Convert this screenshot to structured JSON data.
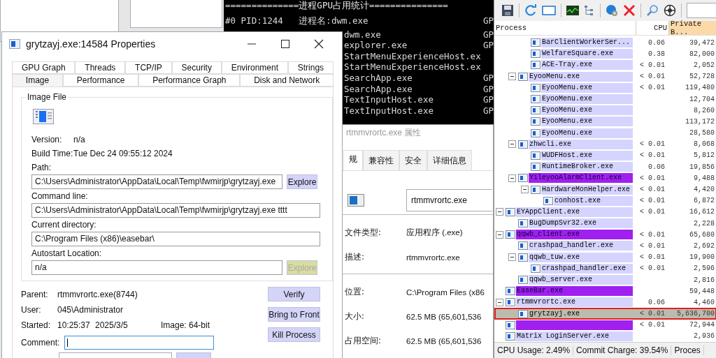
{
  "console": {
    "header": "==============进程GPU占用统计===============",
    "lines": [
      {
        "kind": "full",
        "text": "#0 PID:1244   进程名:dwm.exe",
        "tail": "GP"
      },
      {
        "kind": "tail",
        "text": "dwm.exe",
        "tail": "GP"
      },
      {
        "kind": "tail",
        "text": "explorer.exe",
        "tail": "GP"
      },
      {
        "kind": "tail",
        "text": "StartMenuExperienceHost.ex"
      },
      {
        "kind": "tail",
        "text": "StartMenuExperienceHost.ex"
      },
      {
        "kind": "tail",
        "text": "SearchApp.exe",
        "tail": "GP"
      },
      {
        "kind": "tail",
        "text": "SearchApp.exe",
        "tail": "GP"
      },
      {
        "kind": "tail",
        "text": "TextInputHost.exe",
        "tail": "GP"
      },
      {
        "kind": "tail",
        "text": "TextInputHost.exe",
        "tail": "GP"
      }
    ]
  },
  "properties_cn": {
    "title": "rtmmvrortc.exe 属性",
    "tabs": [
      {
        "label": "规",
        "selected": true
      },
      {
        "label": "兼容性",
        "selected": false
      },
      {
        "label": "安全",
        "selected": false
      },
      {
        "label": "详细信息",
        "selected": false
      }
    ],
    "file_name": "rtmmvrortc.exe",
    "groups": [
      [
        {
          "label": "文件类型:",
          "value": "应用程序 (.exe)"
        },
        {
          "label": "描述:",
          "value": "rtmmvrortc.exe"
        }
      ],
      [
        {
          "label": "位置:",
          "value": "C:\\Program Files (x86"
        },
        {
          "label": "大小:",
          "value": "62.5 MB (65,601,536"
        },
        {
          "label": "占用空间:",
          "value": "62.5 MB (65,601,536"
        }
      ]
    ]
  },
  "properties": {
    "title": "grytzayj.exe:14584 Properties",
    "tabs_row1": [
      {
        "label": "GPU Graph",
        "selected": false
      },
      {
        "label": "Threads",
        "selected": false
      },
      {
        "label": "TCP/IP",
        "selected": false
      },
      {
        "label": "Security",
        "selected": false
      },
      {
        "label": "Environment",
        "selected": false
      },
      {
        "label": "Strings",
        "selected": false
      }
    ],
    "tabs_row2": [
      {
        "label": "Image",
        "selected": true
      },
      {
        "label": "Performance",
        "selected": false
      },
      {
        "label": "Performance Graph",
        "selected": false
      },
      {
        "label": "Disk and Network",
        "selected": false
      }
    ],
    "group_title": "Image File",
    "info": [
      {
        "label": "Version:",
        "value": "n/a"
      },
      {
        "label": "Build Time:",
        "value": "Tue Dec 24 09:55:12 2024"
      }
    ],
    "fields": [
      {
        "label": "Path:",
        "value": "C:\\Users\\Administrator\\AppData\\Local\\Temp\\fwmirjp\\grytzayj.exe",
        "button": {
          "label": "Explore",
          "disabled": false
        }
      },
      {
        "label": "Command line:",
        "value": "C:\\Users\\Administrator\\AppData\\Local\\Temp\\fwmirjp\\grytzayj.exe tttt"
      },
      {
        "label": "Current directory:",
        "value": "C:\\Program Files (x86)\\easebar\\"
      },
      {
        "label": "Autostart Location:",
        "value": "n/a",
        "button": {
          "label": "Explore",
          "disabled": true
        }
      }
    ],
    "parent": {
      "label": "Parent:",
      "value": "rtmmvrortc.exe(8744)"
    },
    "user": {
      "label": "User:",
      "value": "045\\Administrator"
    },
    "started": {
      "label": "Started:",
      "time": "10:25:37",
      "date": "2025/3/5",
      "image": "Image: 64-bit"
    },
    "comment": {
      "label": "Comment:",
      "focused": true
    },
    "buttons": [
      "Verify",
      "Bring to Front",
      "Kill Process"
    ]
  },
  "process_explorer": {
    "columns": [
      {
        "label": "Process",
        "sorted": false
      },
      {
        "label": "CPU",
        "sorted": false
      },
      {
        "label": "Private B...",
        "sorted": true
      }
    ],
    "process_tree": [
      {
        "children": [
          {
            "children": [
              {
                "name": "BarClientWorkerSer...",
                "cpu": "0.06",
                "private": "39,472",
                "color": "#d4d4ff",
                "selected": false
              },
              {
                "name": "WelfareSquare.exe",
                "cpu": "0.38",
                "private": "82,000",
                "color": "#d4d4ff",
                "selected": false
              },
              {
                "name": "ACE-Tray.exe",
                "cpu": "< 0.01",
                "private": "2,052",
                "color": "#d4d4ff",
                "selected": false
              }
            ]
          },
          {
            "name": "EyooMenu.exe",
            "cpu": "< 0.01",
            "private": "52,728",
            "color": "#d4d4ff",
            "selected": false,
            "expanded": true,
            "children": [
              {
                "name": "EyooMenu.exe",
                "cpu": "< 0.01",
                "private": "119,480",
                "color": "#d4d4ff",
                "selected": false
              },
              {
                "name": "EyooMenu.exe",
                "private": "12,704",
                "color": "#d4d4ff",
                "selected": false
              },
              {
                "name": "EyooMenu.exe",
                "private": "8,260",
                "color": "#d4d4ff",
                "selected": false
              },
              {
                "name": "EyooMenu.exe",
                "private": "113,172",
                "color": "#d4d4ff",
                "selected": false
              },
              {
                "name": "EyooMenu.exe",
                "private": "28,580",
                "color": "#d4d4ff",
                "selected": false
              }
            ]
          },
          {
            "name": "zhwcli.exe",
            "cpu": "< 0.01",
            "private": "8,068",
            "color": "#d4d4ff",
            "selected": false,
            "expanded": true,
            "children": [
              {
                "name": "WUDFHost.exe",
                "cpu": "< 0.01",
                "private": "5,812",
                "color": "#d4d4ff",
                "selected": false
              },
              {
                "name": "RuntimeBroker.exe",
                "cpu": "0.06",
                "private": "19,856",
                "color": "#d4d4ff",
                "selected": false
              }
            ]
          },
          {
            "name": "YileyooAlarmClient.exe",
            "cpu": "< 0.01",
            "private": "9,488",
            "color": "#a020f0",
            "selected": false,
            "expanded": true,
            "children": [
              {
                "name": "HardwareMonHelper.exe",
                "cpu": "< 0.01",
                "private": "4,420",
                "color": "#d4d4ff",
                "selected": false,
                "expanded": true,
                "children": [
                  {
                    "name": "conhost.exe",
                    "cpu": "< 0.01",
                    "private": "6,872",
                    "color": "#d4d4ff",
                    "selected": false
                  }
                ]
              }
            ]
          }
        ]
      },
      {
        "name": "EYAppClient.exe",
        "cpu": "< 0.01",
        "private": "16,612",
        "color": "#d4d4ff",
        "selected": false,
        "expanded": true,
        "children": [
          {
            "name": "BugDumpSvr32.exe",
            "private": "2,228",
            "color": "#d4d4ff",
            "selected": false
          }
        ]
      },
      {
        "name": "qqwb_client.exe",
        "cpu": "< 0.01",
        "private": "65,680",
        "color": "#a020f0",
        "selected": false,
        "expanded": true,
        "children": [
          {
            "name": "crashpad_handler.exe",
            "cpu": "< 0.01",
            "private": "2,692",
            "color": "#d4d4ff",
            "selected": false
          },
          {
            "name": "qqwb_tuw.exe",
            "cpu": "< 0.01",
            "private": "19,900",
            "color": "#d4d4ff",
            "selected": false,
            "expanded": true,
            "children": [
              {
                "name": "crashpad_handler.exe",
                "cpu": "< 0.01",
                "private": "2,596",
                "color": "#d4d4ff",
                "selected": false
              }
            ]
          },
          {
            "name": "qqwb_server.exe",
            "private": "2,816",
            "color": "#d4d4ff",
            "selected": false
          }
        ]
      },
      {
        "name": "EaseBar.exe",
        "private": "59,448",
        "color": "#a020f0",
        "selected": false
      },
      {
        "name": "rtmmvrortc.exe",
        "cpu": "0.06",
        "private": "4,460",
        "color": "#d4d4ff",
        "selected": false,
        "expanded": true,
        "children": [
          {
            "name": "grytzayj.exe",
            "cpu": "< 0.01",
            "private": "5,636,700",
            "color": "#bcbcae",
            "selected": true
          }
        ]
      },
      {
        "cpu": "< 0.01",
        "private": "72,944",
        "color": "#a020f0",
        "selected": false
      },
      {
        "name": "Matrix LoginServer.exe",
        "private": "2,936",
        "color": "#d4d4ff",
        "selected": false
      }
    ],
    "status_bar": [
      "CPU Usage: 2.49%",
      "Commit Charge: 39.54%",
      "Proces"
    ]
  }
}
